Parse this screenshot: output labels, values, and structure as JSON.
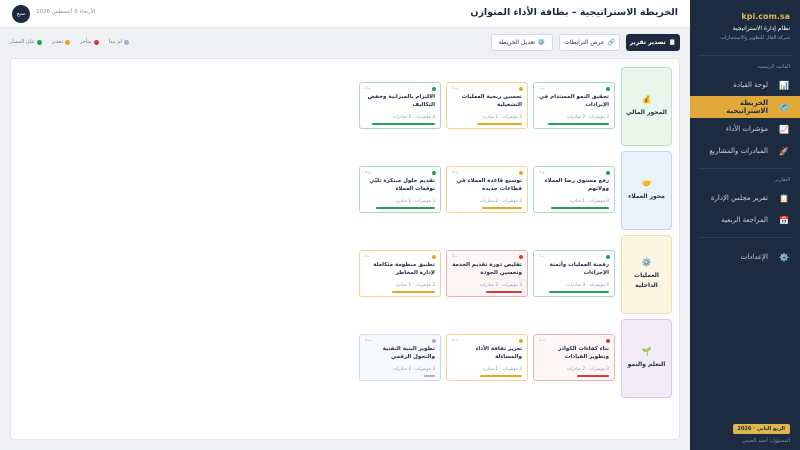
{
  "colors": {
    "sidebar_bg": "#1c2b40",
    "accent": "#e0a93a",
    "status_on_track": "#1fa25a",
    "status_attention": "#e5a91b",
    "status_late": "#d93b3b",
    "status_not_started": "#9db4d6"
  },
  "sidebar": {
    "domain": "kpi.com.sa",
    "system_name": "نظام إدارة الاستراتيجية",
    "org": "شركة الفال للتطوير والاستثمارات",
    "section_main": "القائمة الرئيسية",
    "items": [
      {
        "label": "لوحة القيادة",
        "icon": "chart-icon"
      },
      {
        "label": "الخريطة الاستراتيجية",
        "icon": "map-icon"
      },
      {
        "label": "مؤشرات الأداء",
        "icon": "trend-icon"
      },
      {
        "label": "المبادرات والمشاريع",
        "icon": "rocket-icon"
      }
    ],
    "section_reports": "التقارير",
    "report_items": [
      {
        "label": "تقرير مجلس الإدارة",
        "icon": "clipboard-icon"
      },
      {
        "label": "المراجعة الربعية",
        "icon": "calendar-icon"
      }
    ],
    "settings_label": "الإعدادات",
    "settings_icon": "gear-icon",
    "quarter_badge": "الربع الثاني · 2026",
    "user": "المسؤول: أحمد العتيبي"
  },
  "header": {
    "title": "الخريطة الاستراتيجية – بطاقة الأداء المتوازن",
    "date": "الأربعاء 6 أغسطس 2026",
    "avatar": "سبع"
  },
  "toolbar": {
    "export_label": "تصدير تقرير",
    "export_icon": "clipboard-icon",
    "relations_label": "عرض الترابطات",
    "relations_icon": "link-icon",
    "edit_label": "تعديل الخريطة",
    "edit_icon": "gear-icon"
  },
  "legend": [
    {
      "label": "على المسار",
      "color": "#1fa25a"
    },
    {
      "label": "تحذير",
      "color": "#e5a91b"
    },
    {
      "label": "متأخر",
      "color": "#d93b3b"
    },
    {
      "label": "لم يبدأ",
      "color": "#9db4d6"
    }
  ],
  "perspectives": [
    {
      "label": "المحور المالي",
      "icon": "money-bag-icon",
      "bg": "#e8f6ec",
      "border": "#b9e2c6",
      "text": "#1c2b40",
      "objectives": [
        {
          "code": "م-1",
          "title": "تحقيق النمو المستدام في الإيرادات",
          "meta": "3 مؤشرات · 2 مبادرات",
          "status": "on_track",
          "progress": 0.85
        },
        {
          "code": "م-2",
          "title": "تحسين ربحية العمليات التشغيلية",
          "meta": "2 مؤشرات · 1 مبادرة",
          "status": "attention",
          "progress": 0.62
        },
        {
          "code": "م-3",
          "title": "الالتزام بالميزانية وخفض التكاليف",
          "meta": "4 مؤشرات · 2 مبادرات",
          "status": "on_track",
          "progress": 0.88
        }
      ]
    },
    {
      "label": "محور العملاء",
      "icon": "handshake-icon",
      "bg": "#e9f1fb",
      "border": "#c3d6ef",
      "text": "#1c2b40",
      "objectives": [
        {
          "code": "ع-1",
          "title": "رفع مستوى رضا العملاء وولائهم",
          "meta": "3 مؤشرات · 1 مبادرة",
          "status": "on_track",
          "progress": 0.8
        },
        {
          "code": "ع-2",
          "title": "توسيع قاعدة العملاء في قطاعات جديدة",
          "meta": "2 مؤشرات · 2 مبادرات",
          "status": "attention",
          "progress": 0.55
        },
        {
          "code": "ع-3",
          "title": "تقديم حلول مبتكرة تلبّي توقعات العملاء",
          "meta": "3 مؤشرات · 1 مبادرة",
          "status": "on_track",
          "progress": 0.82
        }
      ]
    },
    {
      "label": "العمليات الداخلية",
      "icon": "gear-icon",
      "bg": "#fdf4e2",
      "border": "#f0dcae",
      "text": "#1c2b40",
      "objectives": [
        {
          "code": "د-1",
          "title": "رقمنة العمليات وأتمتة الإجراءات",
          "meta": "4 مؤشرات · 3 مبادرات",
          "status": "on_track",
          "progress": 0.83
        },
        {
          "code": "د-2",
          "title": "تقليص دورة تقديم الخدمة وتحسين الجودة",
          "meta": "3 مؤشرات · 2 مبادرات",
          "status": "late",
          "progress": 0.5
        },
        {
          "code": "د-3",
          "title": "تطبيق منظومة متكاملة لإدارة المخاطر",
          "meta": "2 مؤشرات · 1 مبادرة",
          "status": "attention",
          "progress": 0.6
        }
      ]
    },
    {
      "label": "التعلم والنمو",
      "icon": "seedling-icon",
      "bg": "#f2ecf8",
      "border": "#d9c9ea",
      "text": "#1c2b40",
      "objectives": [
        {
          "code": "ت-1",
          "title": "بناء كفاءات الكوادر وتطوير القيادات",
          "meta": "3 مؤشرات · 2 مبادرات",
          "status": "late",
          "progress": 0.45
        },
        {
          "code": "ت-2",
          "title": "تعزيز ثقافة الأداء والمساءلة",
          "meta": "2 مؤشرات · 1 مبادرة",
          "status": "attention",
          "progress": 0.58
        },
        {
          "code": "ت-3",
          "title": "تطوير البنية التقنية والتحول الرقمي",
          "meta": "3 مؤشرات · 2 مبادرات",
          "status": "not_started",
          "progress": 0.15
        }
      ]
    }
  ]
}
